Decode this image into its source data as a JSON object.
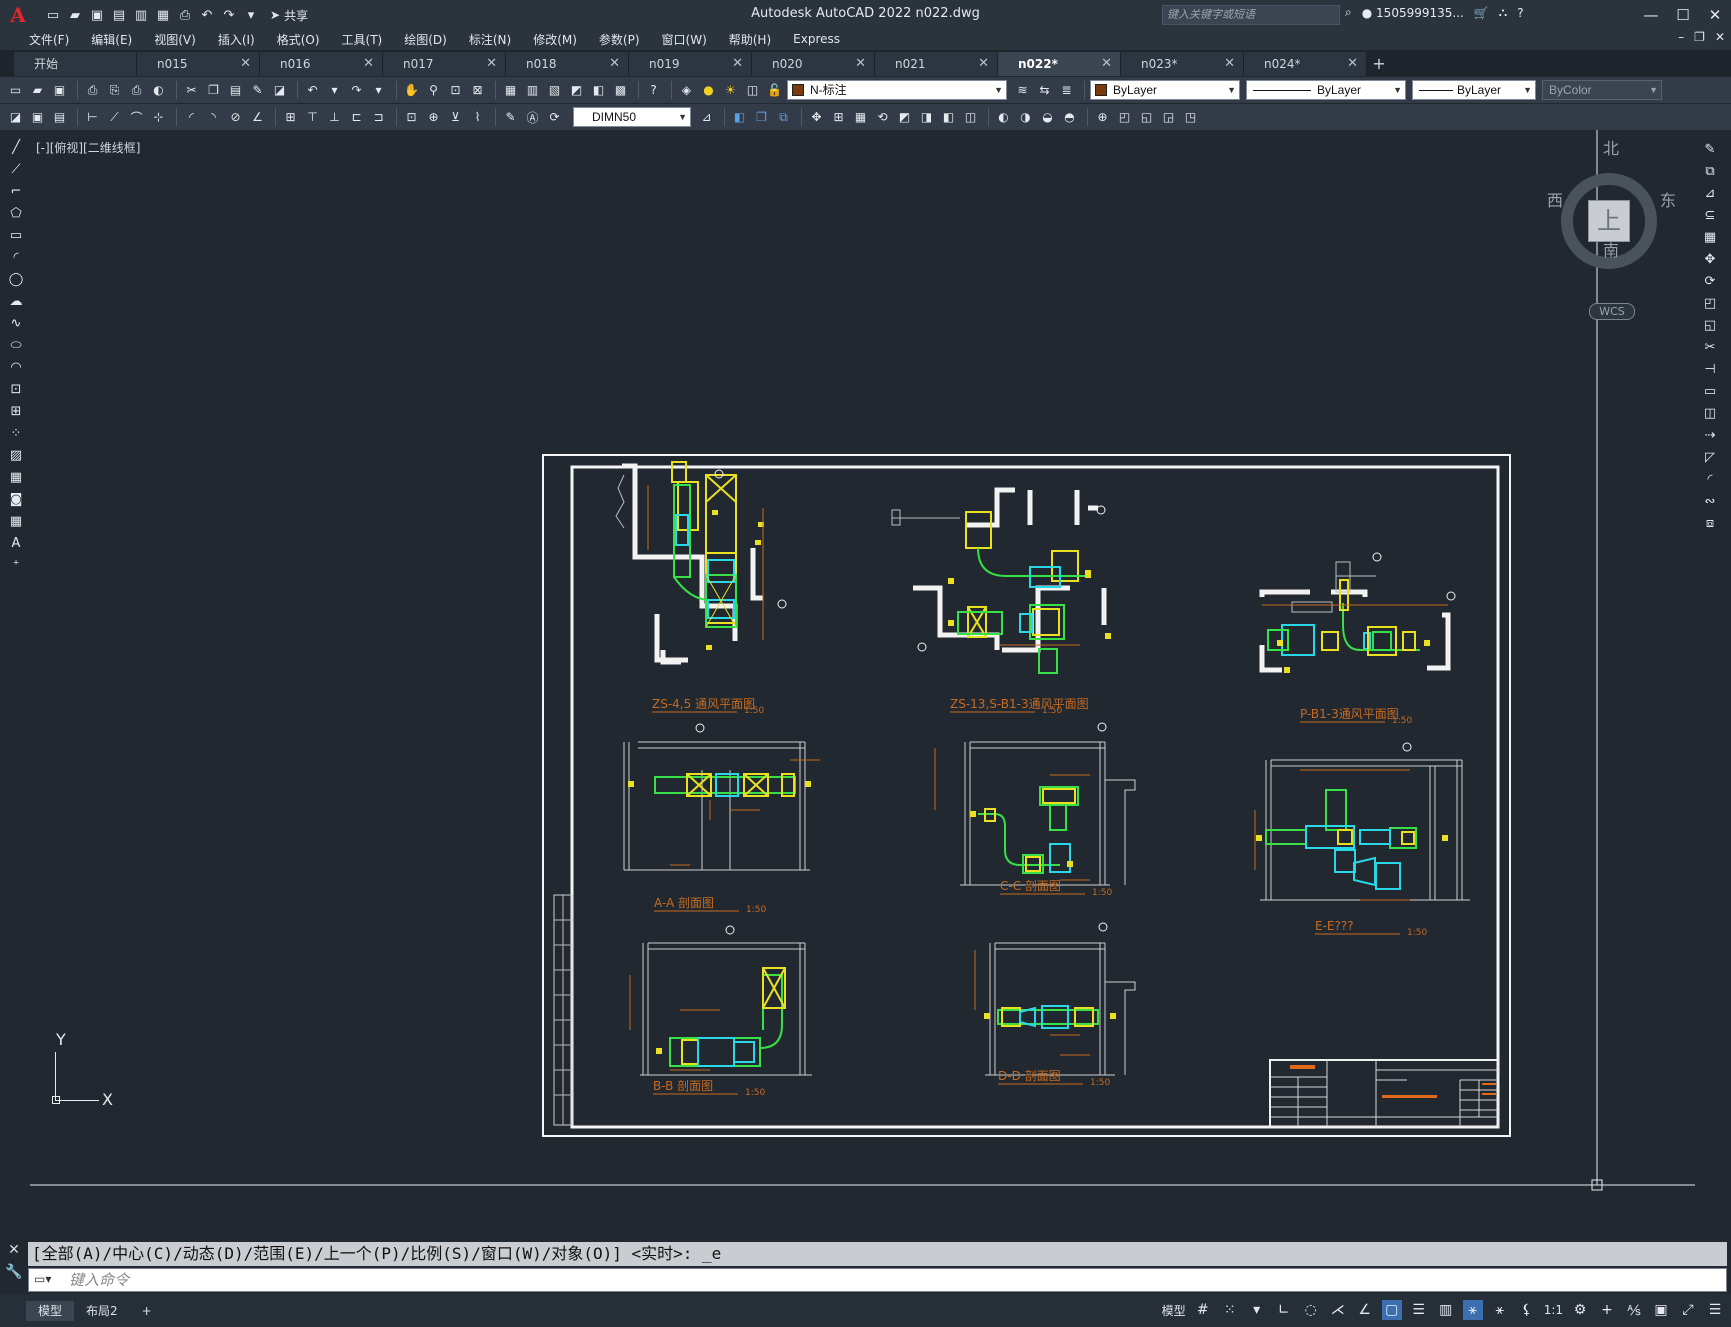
{
  "titlebar": {
    "app_title": "Autodesk AutoCAD 2022    n022.dwg",
    "share_label": "共享",
    "search_placeholder": "键入关键字或短语",
    "user": "1505999135...",
    "logo": "A"
  },
  "menu": [
    "文件(F)",
    "编辑(E)",
    "视图(V)",
    "插入(I)",
    "格式(O)",
    "工具(T)",
    "绘图(D)",
    "标注(N)",
    "修改(M)",
    "参数(P)",
    "窗口(W)",
    "帮助(H)",
    "Express"
  ],
  "tabs": [
    {
      "label": "开始",
      "active": false,
      "closable": false
    },
    {
      "label": "n015",
      "active": false,
      "closable": true
    },
    {
      "label": "n016",
      "active": false,
      "closable": true
    },
    {
      "label": "n017",
      "active": false,
      "closable": true
    },
    {
      "label": "n018",
      "active": false,
      "closable": true
    },
    {
      "label": "n019",
      "active": false,
      "closable": true
    },
    {
      "label": "n020",
      "active": false,
      "closable": true
    },
    {
      "label": "n021",
      "active": false,
      "closable": true
    },
    {
      "label": "n022*",
      "active": true,
      "closable": true
    },
    {
      "label": "n023*",
      "active": false,
      "closable": true
    },
    {
      "label": "n024*",
      "active": false,
      "closable": true
    }
  ],
  "toolbar": {
    "layer": "N-标注",
    "color": "ByLayer",
    "linetype": "ByLayer",
    "lineweight": "ByLayer",
    "plotstyle": "ByColor",
    "dimstyle": "DIMN50"
  },
  "viewport_label": "[-][俯视][二维线框]",
  "viewcube": {
    "north": "北",
    "south": "南",
    "east": "东",
    "west": "西",
    "top": "上",
    "wcs": "WCS"
  },
  "ucs": {
    "x": "X",
    "y": "Y"
  },
  "command": {
    "history": "[全部(A)/中心(C)/动态(D)/范围(E)/上一个(P)/比例(S)/窗口(W)/对象(O)] <实时>: _e",
    "placeholder": "键入命令"
  },
  "status": {
    "tabs": [
      {
        "label": "模型",
        "active": true
      },
      {
        "label": "布局2",
        "active": false
      }
    ],
    "model_label": "模型",
    "scale": "1:1"
  },
  "drawing": {
    "titles": [
      {
        "name": "ZS-4,5 ",
        "suffix": "通风平面图",
        "scale": "1:50"
      },
      {
        "name": "ZS-13,S-B1-3",
        "suffix": "通风平面图",
        "scale": "1:50"
      },
      {
        "name": "P-B1-3",
        "suffix": "通风平面图",
        "scale": "1:50"
      },
      {
        "name": "A-A ",
        "suffix": "剖面图",
        "scale": "1:50"
      },
      {
        "name": "C-C ",
        "suffix": "剖面图",
        "scale": "1:50"
      },
      {
        "name": "E-E???",
        "suffix": "",
        "scale": "1:50"
      },
      {
        "name": "B-B ",
        "suffix": "剖面图",
        "scale": "1:50"
      },
      {
        "name": "D-D ",
        "suffix": "剖面图",
        "scale": "1:50"
      }
    ]
  },
  "colors": {
    "background": "#212830",
    "accent": "#3c6fb0",
    "duct_yellow": "#e8e020",
    "duct_cyan": "#29d7e6",
    "duct_green": "#36e046",
    "label_orange": "#c86a1e"
  }
}
